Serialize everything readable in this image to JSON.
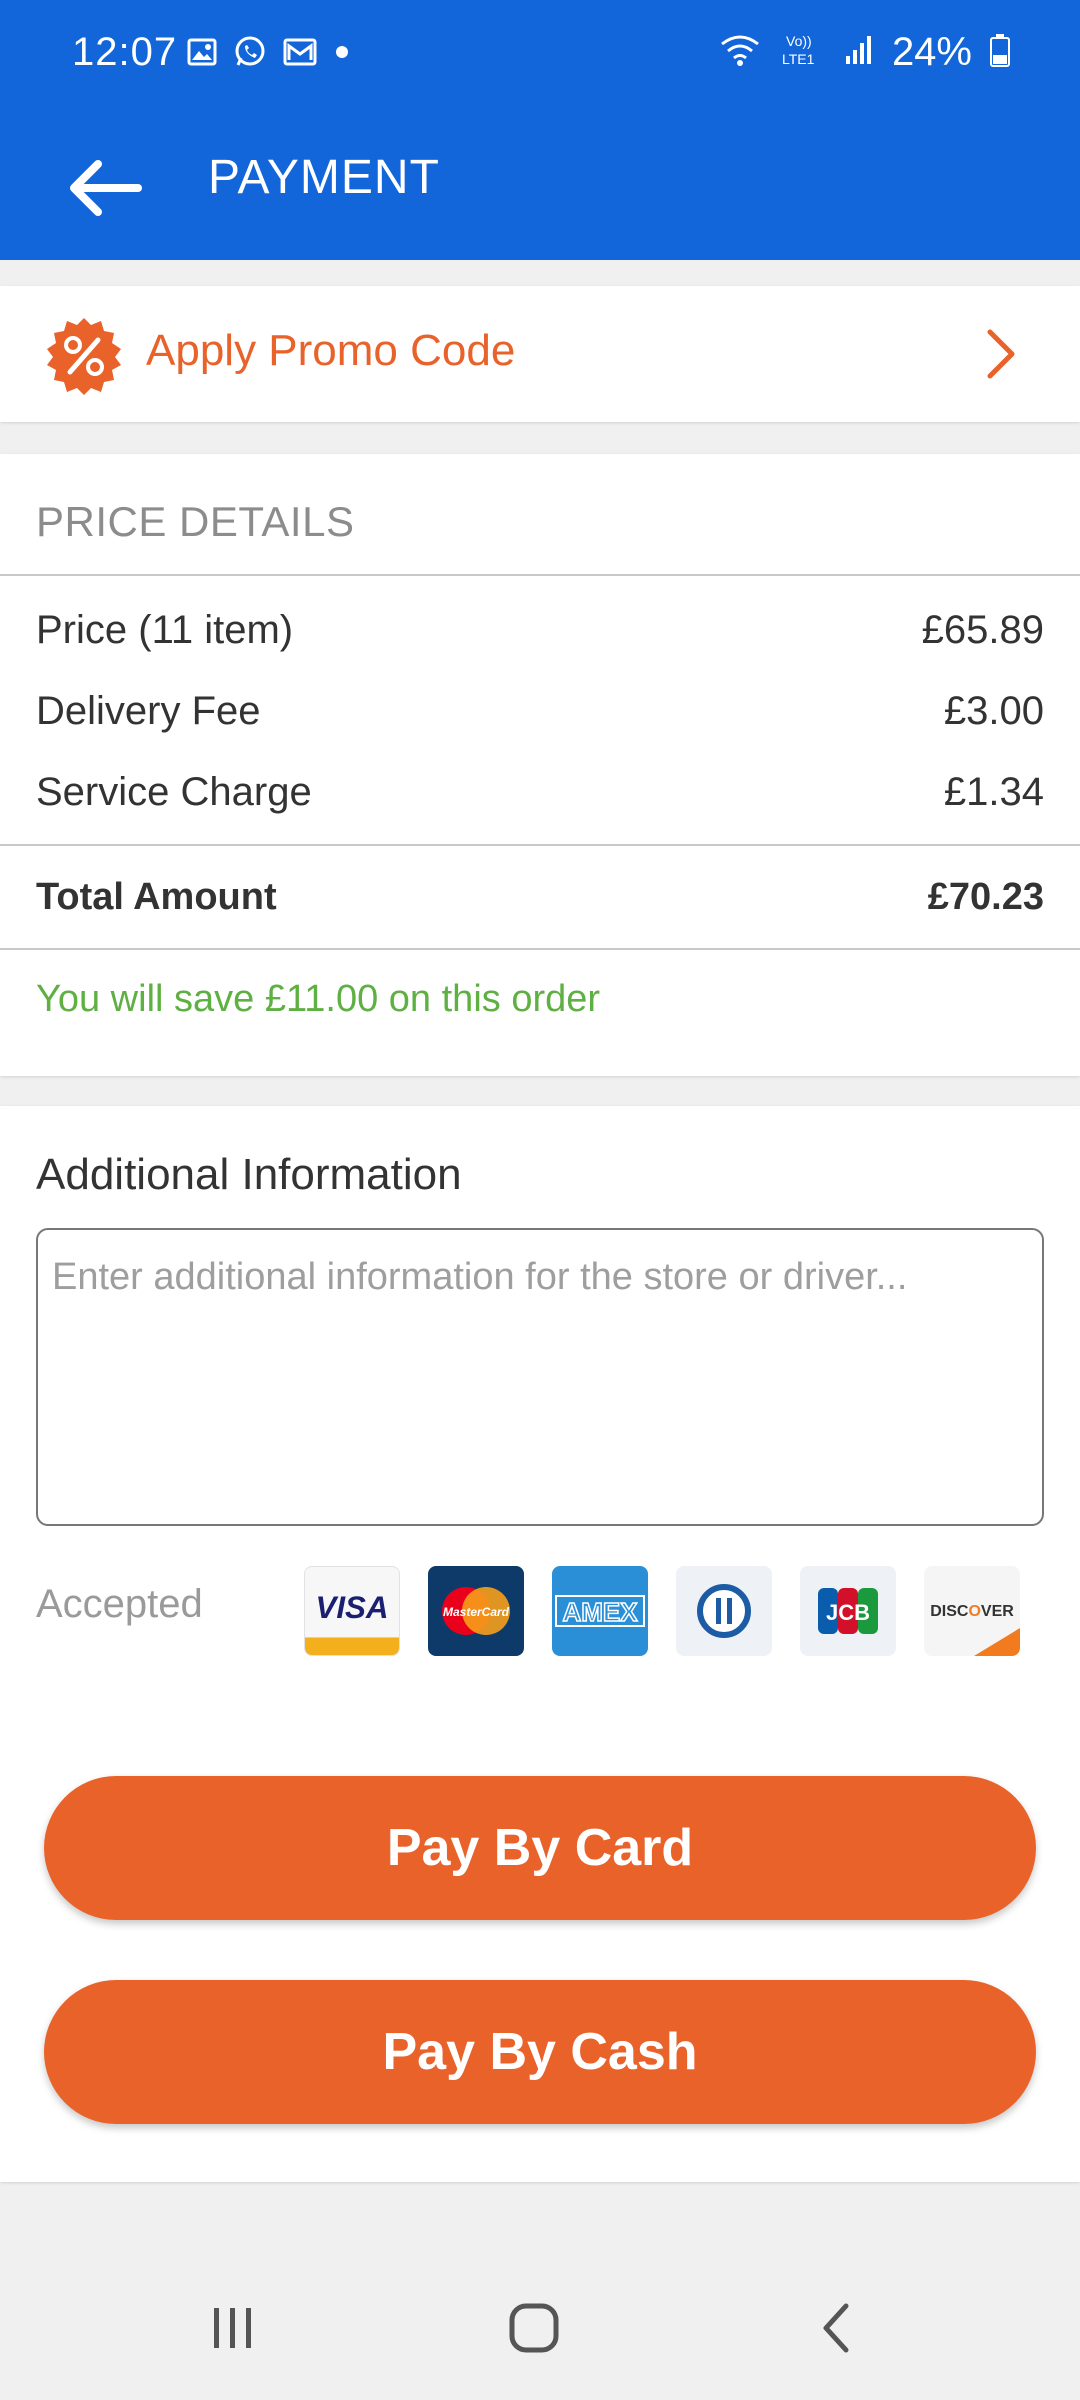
{
  "status_bar": {
    "time": "12:07",
    "battery": "24%",
    "notification_icons": [
      "gallery-icon",
      "whatsapp-icon",
      "mail-icon",
      "dot-icon"
    ],
    "system_icons": [
      "wifi-icon",
      "volte-lte-icon",
      "signal-icon",
      "battery-icon"
    ]
  },
  "header": {
    "title": "PAYMENT",
    "back_icon": "back-arrow-icon"
  },
  "promo": {
    "label": "Apply Promo Code",
    "icon": "percent-badge-icon",
    "chevron_icon": "chevron-right-icon"
  },
  "price_details": {
    "title": "PRICE DETAILS",
    "rows": [
      {
        "label": "Price (11 item)",
        "value": "£65.89"
      },
      {
        "label": "Delivery Fee",
        "value": "£3.00"
      },
      {
        "label": "Service Charge",
        "value": "£1.34"
      }
    ],
    "total": {
      "label": "Total Amount",
      "value": "£70.23"
    },
    "savings": "You will save £11.00 on this order"
  },
  "additional_info": {
    "title": "Additional Information",
    "placeholder": "Enter additional information for the store or driver...",
    "value": ""
  },
  "accepted": {
    "label": "Accepted",
    "cards": [
      {
        "name": "VISA",
        "icon": "visa-card-icon"
      },
      {
        "name": "MasterCard",
        "icon": "mastercard-card-icon"
      },
      {
        "name": "AMEX",
        "icon": "amex-card-icon"
      },
      {
        "name": "Diners Club",
        "icon": "diners-card-icon"
      },
      {
        "name": "JCB",
        "icon": "jcb-card-icon"
      },
      {
        "name": "DISCOVER",
        "icon": "discover-card-icon"
      }
    ]
  },
  "buttons": {
    "pay_card": "Pay By Card",
    "pay_cash": "Pay By Cash"
  },
  "colors": {
    "header_blue": "#1266d9",
    "accent_orange": "#e8622a",
    "savings_green": "#5fb043"
  }
}
